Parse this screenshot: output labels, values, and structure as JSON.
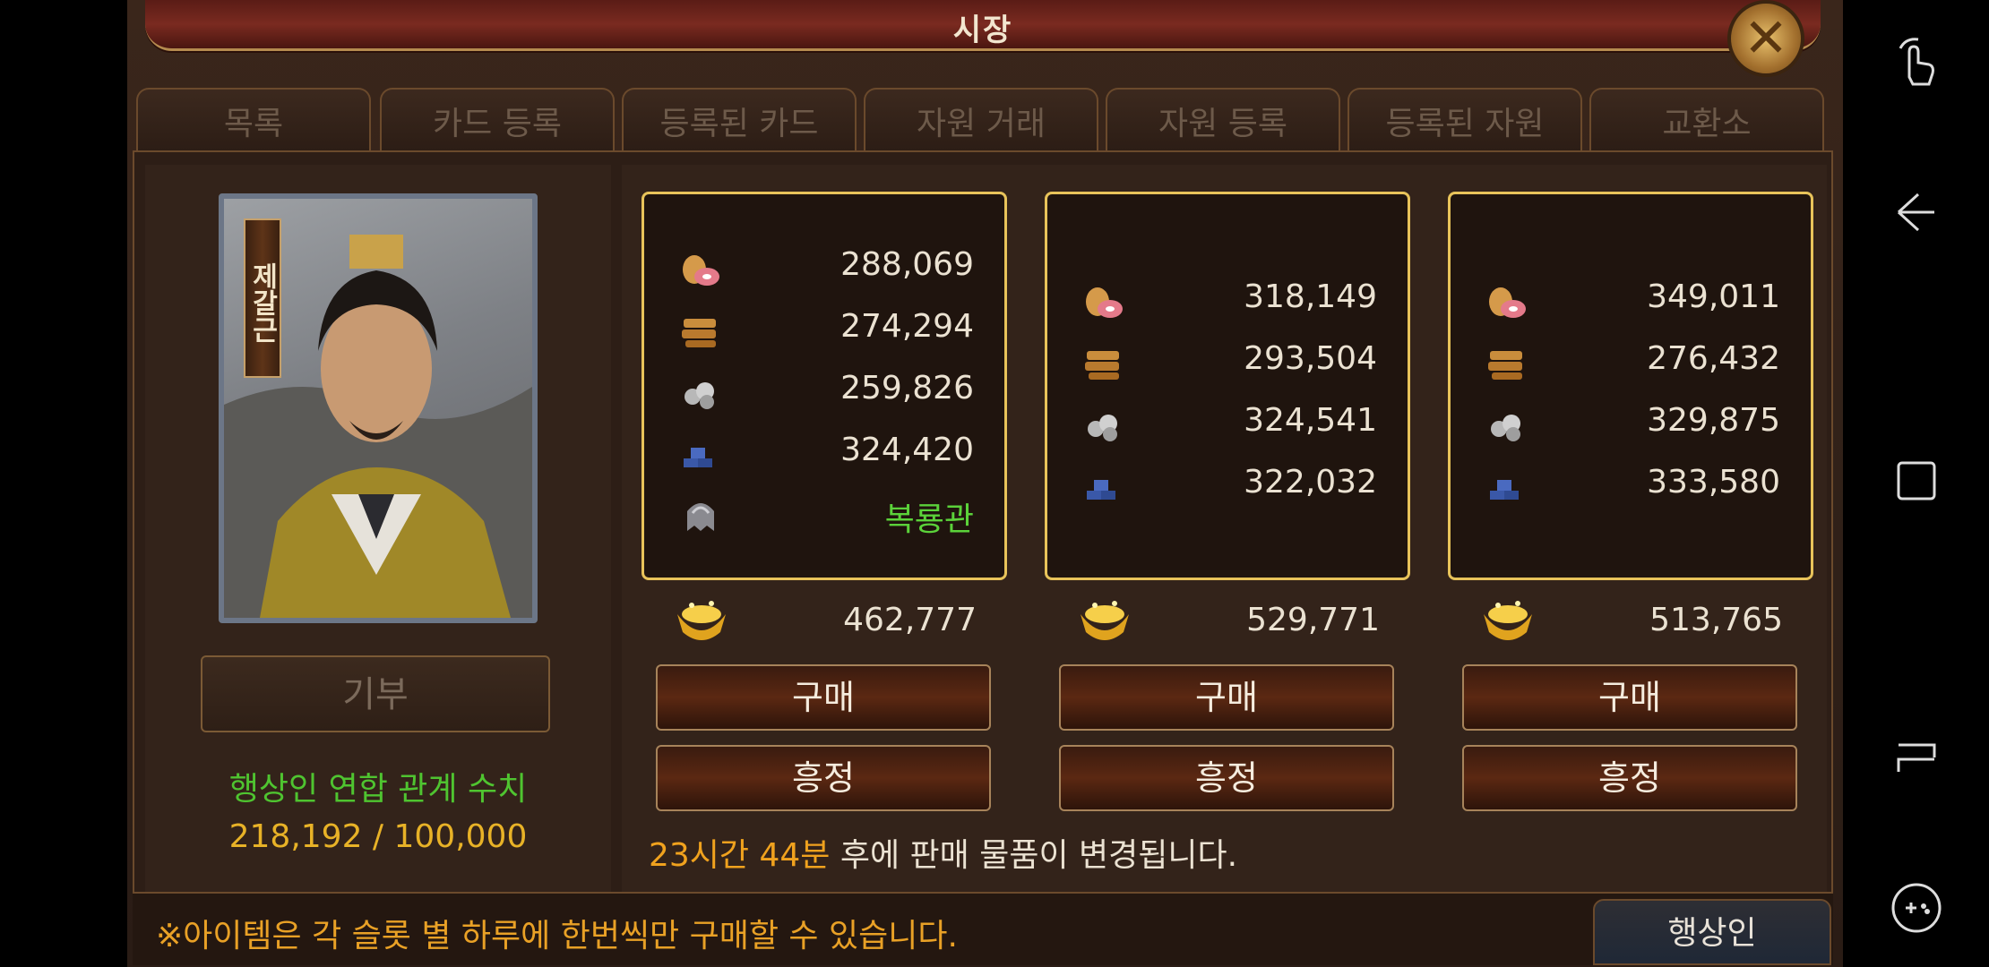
{
  "window": {
    "title": "시장"
  },
  "tabs": [
    "목록",
    "카드 등록",
    "등록된 카드",
    "자원 거래",
    "자원 등록",
    "등록된 자원",
    "교환소"
  ],
  "general": {
    "name": "제갈근"
  },
  "left": {
    "donate_label": "기부",
    "relation_label": "행상인 연합 관계 수치",
    "relation_value": "218,192 / 100,000"
  },
  "offers": [
    {
      "resources": [
        {
          "icon": "food-icon",
          "value": "288,069"
        },
        {
          "icon": "wood-icon",
          "value": "274,294"
        },
        {
          "icon": "stone-icon",
          "value": "259,826"
        },
        {
          "icon": "iron-icon",
          "value": "324,420"
        },
        {
          "icon": "helmet-icon",
          "value": "복룡관"
        }
      ],
      "gold": "462,777",
      "buy_label": "구매",
      "haggle_label": "흥정"
    },
    {
      "resources": [
        {
          "icon": "food-icon",
          "value": "318,149"
        },
        {
          "icon": "wood-icon",
          "value": "293,504"
        },
        {
          "icon": "stone-icon",
          "value": "324,541"
        },
        {
          "icon": "iron-icon",
          "value": "322,032"
        }
      ],
      "gold": "529,771",
      "buy_label": "구매",
      "haggle_label": "흥정"
    },
    {
      "resources": [
        {
          "icon": "food-icon",
          "value": "349,011"
        },
        {
          "icon": "wood-icon",
          "value": "276,432"
        },
        {
          "icon": "stone-icon",
          "value": "329,875"
        },
        {
          "icon": "iron-icon",
          "value": "333,580"
        }
      ],
      "gold": "513,765",
      "buy_label": "구매",
      "haggle_label": "흥정"
    }
  ],
  "timer": {
    "time": "23시간 44분",
    "suffix": " 후에 판매 물품이 변경됩니다."
  },
  "footer": {
    "notice": "※아이템은 각 슬롯 별 하루에 한번씩만 구매할 수 있습니다.",
    "merchant_label": "행상인"
  },
  "colors": {
    "highlight_green": "#5bd23a",
    "gold_text": "#e8b227",
    "box_border": "#e8c35a"
  }
}
